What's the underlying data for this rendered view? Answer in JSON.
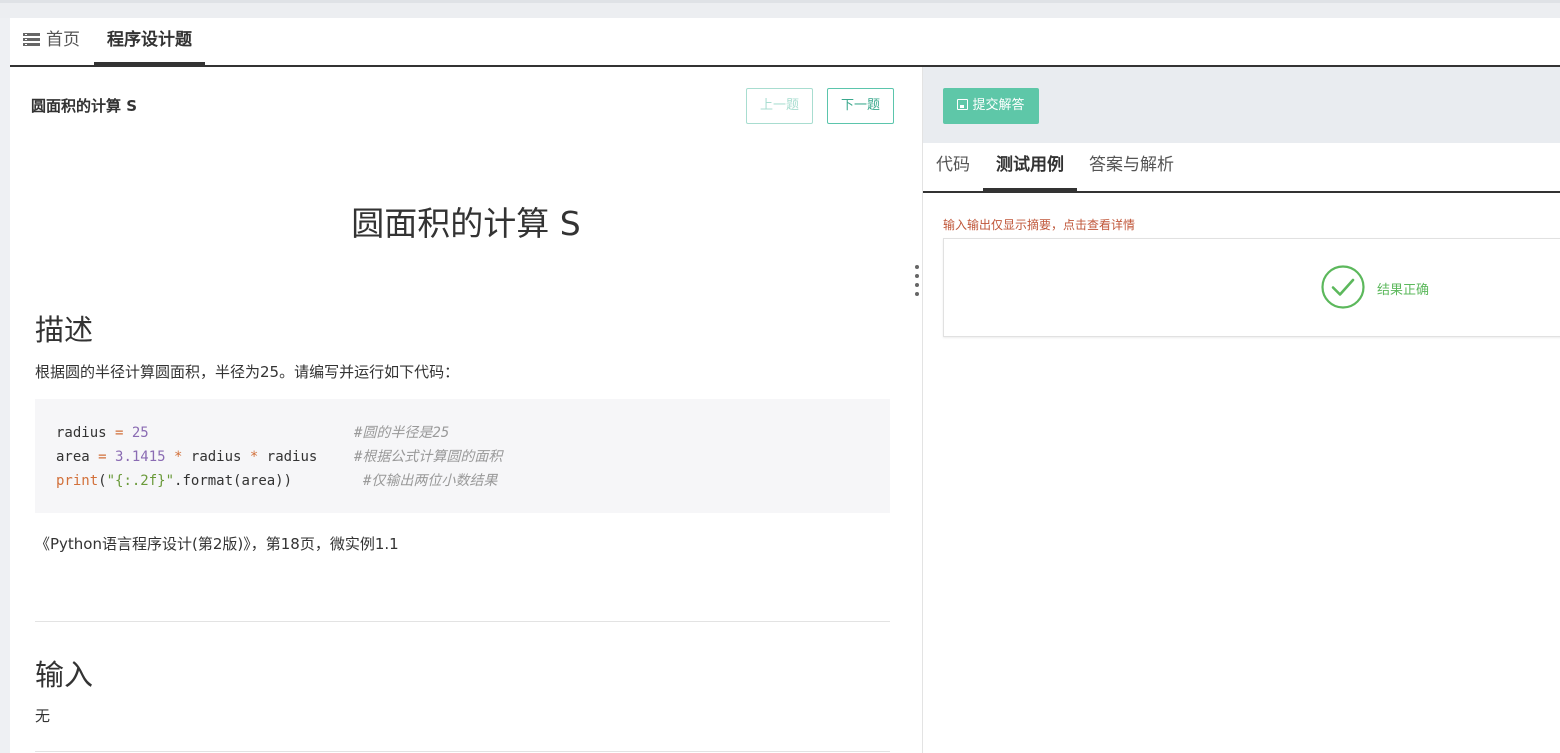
{
  "tabs": {
    "home_label": "首页",
    "current_label": "程序设计题"
  },
  "problem": {
    "small_title": "圆面积的计算 S",
    "prev_label": "上一题",
    "next_label": "下一题",
    "big_title": "圆面积的计算 S",
    "desc_heading": "描述",
    "desc_text": "根据圆的半径计算圆面积，半径为25。请编写并运行如下代码：",
    "code": {
      "l1_var": "radius",
      "l1_eq": " = ",
      "l1_num": "25",
      "l1_comment": "#圆的半径是25",
      "l2_var": "area",
      "l2_eq": " = ",
      "l2_num": "3.1415",
      "l2_star1": " * ",
      "l2_r1": "radius",
      "l2_star2": " * ",
      "l2_r2": "radius",
      "l2_comment": "#根据公式计算圆的面积",
      "l3_kw": "print",
      "l3_open": "(",
      "l3_str": "\"{:.2f}\"",
      "l3_rest": ".format(area))",
      "l3_comment": "#仅输出两位小数结果"
    },
    "reference": "《Python语言程序设计(第2版)》，第18页，微实例1.1",
    "input_heading": "输入",
    "input_text": "无"
  },
  "right": {
    "submit_label": "提交解答",
    "tab_code": "代码",
    "tab_test": "测试用例",
    "tab_answer": "答案与解析",
    "hint": "输入输出仅显示摘要，点击查看详情",
    "result": "结果正确"
  },
  "colors": {
    "accent": "#5ec7a8",
    "success": "#5cb85c",
    "hint": "#c0573a"
  }
}
